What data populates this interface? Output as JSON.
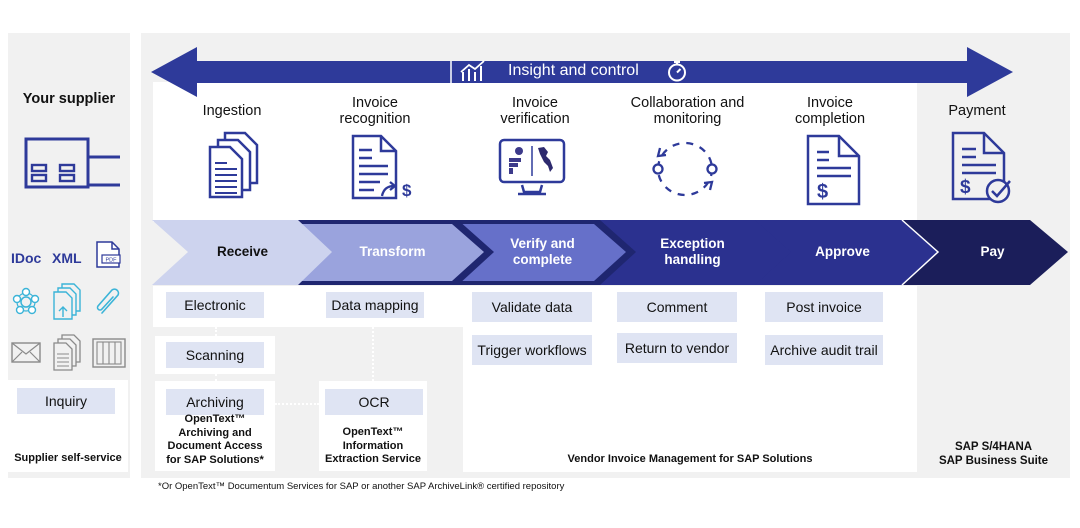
{
  "supplier": {
    "title": "Your supplier",
    "formats": [
      "IDoc",
      "XML"
    ],
    "icons": [
      "factory-icon",
      "pdf-icon",
      "network-icon",
      "upload-documents-icon",
      "paperclip-icon",
      "envelope-icon",
      "paper-documents-icon",
      "filing-cabinet-icon"
    ],
    "inquiry_chip": "Inquiry",
    "footer": "Supplier self-service"
  },
  "banner": {
    "label": "Insight and control",
    "icons": [
      "chart-growth-icon",
      "stopwatch-icon"
    ]
  },
  "stages": [
    {
      "title": "Ingestion",
      "icon": "document-stack-icon"
    },
    {
      "title": "Invoice recognition",
      "icon": "invoice-transform-icon"
    },
    {
      "title": "Invoice verification",
      "icon": "monitor-dashboard-icon"
    },
    {
      "title": "Collaboration and monitoring",
      "icon": "cycle-icon"
    },
    {
      "title": "Invoice completion",
      "icon": "invoice-dollar-icon"
    },
    {
      "title": "Payment",
      "icon": "invoice-approved-icon"
    }
  ],
  "process": [
    {
      "label": "Receive",
      "color": "#cdd3ee",
      "text_color": "#111111"
    },
    {
      "label": "Transform",
      "color": "#9aa3dd",
      "text_color": "#ffffff"
    },
    {
      "label": "Verify and complete",
      "color": "#6670c9",
      "text_color": "#ffffff"
    },
    {
      "label": "Exception handling",
      "color": "#2b318f",
      "text_color": "#ffffff"
    },
    {
      "label": "Approve",
      "color": "#2b318f",
      "text_color": "#ffffff"
    },
    {
      "label": "Pay",
      "color": "#1b1e5a",
      "text_color": "#ffffff"
    }
  ],
  "chips": {
    "receive": [
      "Electronic",
      "Scanning",
      "Archiving"
    ],
    "transform": [
      "Data mapping",
      "OCR"
    ],
    "verify": [
      "Validate data",
      "Trigger workflows"
    ],
    "exception": [
      "Comment",
      "Return to vendor"
    ],
    "approve": [
      "Post invoice",
      "Archive audit trail"
    ]
  },
  "products": {
    "archiving": "OpenText™ Archiving and Document Access for SAP Solutions*",
    "ocr": "OpenText™ Information Extraction Service",
    "vim": "Vendor Invoice Management for SAP Solutions",
    "sap_line1": "SAP S/4HANA",
    "sap_line2": "SAP Business Suite"
  },
  "footnote": "*Or OpenText™ Documentum Services for SAP or another SAP ArchiveLink® certified repository",
  "colors": {
    "brand_blue": "#2e3a9a",
    "navy": "#1b1e5a",
    "chip_bg": "#dfe4f3",
    "panel_gray": "#f1f1f1",
    "cyan_icon": "#3bb4d8",
    "gray_icon": "#8a8a8a"
  }
}
